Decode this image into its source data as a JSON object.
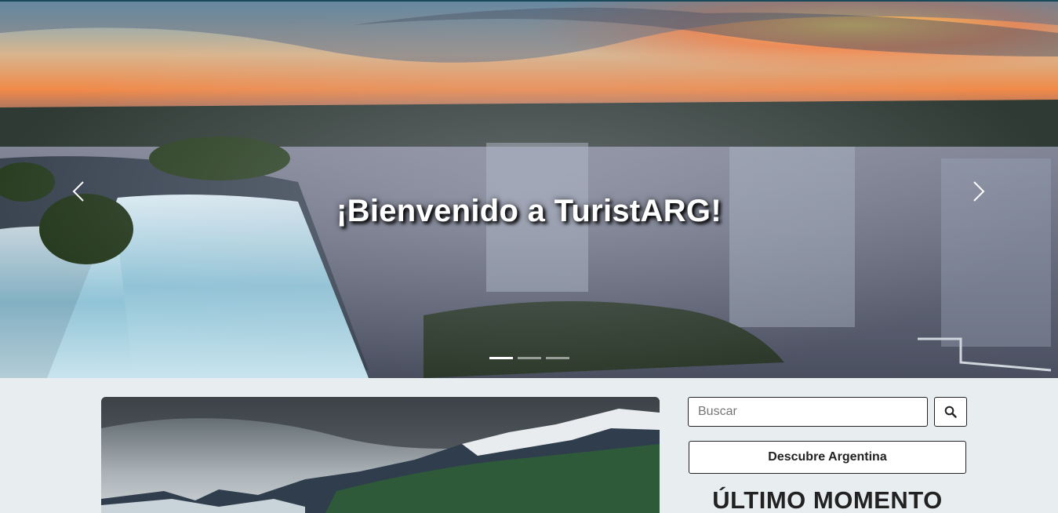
{
  "hero": {
    "title": "¡Bienvenido a TuristARG!",
    "image": "iguazu-falls-sunset",
    "prev_icon": "chevron-left-icon",
    "next_icon": "chevron-right-icon",
    "slides": 3,
    "active_slide": 1
  },
  "card": {
    "image": "patagonia-mountains"
  },
  "sidebar": {
    "search_placeholder": "Buscar",
    "search_value": "",
    "search_icon": "search-icon",
    "discover_label": "Descubre Argentina",
    "latest_heading": "ÚLTIMO MOMENTO"
  },
  "colors": {
    "page_bg": "#e8edf0",
    "text_dark": "#222222",
    "hero_text": "#ffffff"
  }
}
